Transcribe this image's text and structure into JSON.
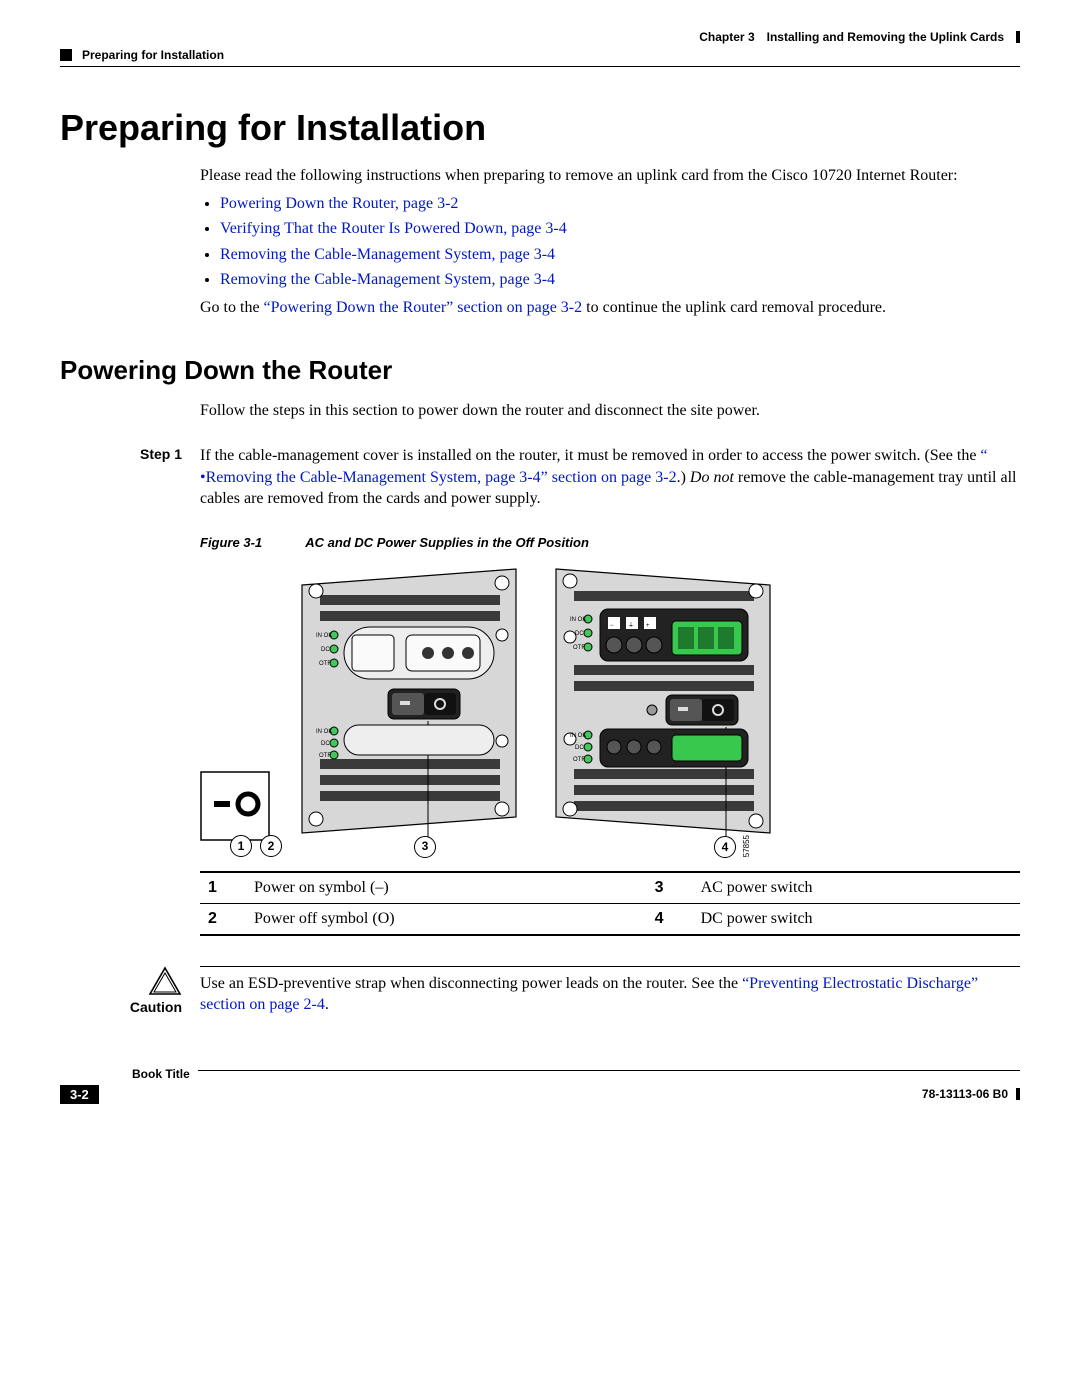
{
  "header": {
    "chapter": "Chapter 3",
    "chapter_title": "Installing and Removing the Uplink Cards",
    "section": "Preparing for Installation"
  },
  "h1": "Preparing for Installation",
  "intro": "Please read the following instructions when preparing to remove an uplink card from the Cisco 10720 Internet Router:",
  "bullets": [
    "Powering Down the Router, page 3-2",
    "Verifying That the Router Is Powered Down, page 3-4",
    "Removing the Cable-Management System, page 3-4",
    "Removing the Cable-Management System, page 3-4"
  ],
  "goto_prefix": "Go to the ",
  "goto_link": "“Powering Down the Router” section on page 3-2",
  "goto_suffix": " to continue the uplink card removal procedure.",
  "h2": "Powering Down the Router",
  "h2_intro": "Follow the steps in this section to power down the router and disconnect the site power.",
  "step1_label": "Step 1",
  "step1_a": "If the cable-management cover is installed on the router, it must be removed in order to access the power switch. (See the ",
  "step1_link": "“  •Removing the Cable-Management System, page 3-4” section on page 3-2",
  "step1_b": ".) ",
  "step1_c": "Do not",
  "step1_d": " remove the cable-management tray until all cables are removed from the cards and power supply.",
  "figure": {
    "num": "Figure 3-1",
    "title": "AC and DC Power Supplies in the Off Position",
    "artnum": "57855",
    "labels": {
      "inok": "IN OK",
      "dc": "DC",
      "otf": "OTF"
    }
  },
  "legend": [
    {
      "n": "1",
      "t": "Power on symbol (–)"
    },
    {
      "n": "3",
      "t": "AC power switch"
    },
    {
      "n": "2",
      "t": "Power off symbol (O)"
    },
    {
      "n": "4",
      "t": "DC power switch"
    }
  ],
  "caution": {
    "label": "Caution",
    "text_a": "Use an ESD-preventive strap when disconnecting power leads on the router. See the ",
    "link": "“Preventing Electrostatic Discharge” section on page 2-4",
    "text_b": "."
  },
  "footer": {
    "book": "Book Title",
    "page": "3-2",
    "docnum": "78-13113-06 B0"
  }
}
